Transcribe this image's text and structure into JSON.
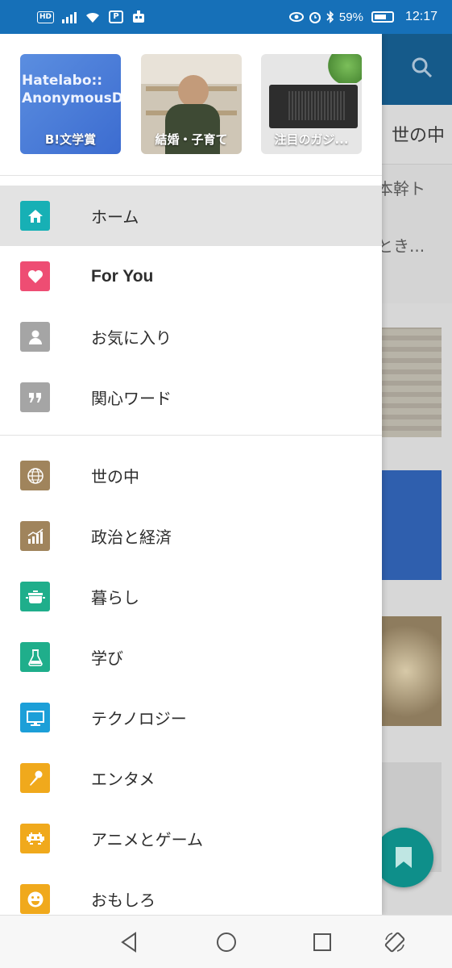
{
  "status_bar": {
    "badge": "HD",
    "battery": "59%",
    "time": "12:17",
    "color": "#1670b8"
  },
  "background_app": {
    "tab": "世の中",
    "article_line1": "本幹ト",
    "article_line2": "とき..."
  },
  "featured": [
    {
      "label": "B!文学賞",
      "overlay": "Hatelabo::\nAnonymousDiary"
    },
    {
      "label": "結婚・子育て"
    },
    {
      "label": "注目のガジ..."
    }
  ],
  "menu_primary": [
    {
      "label": "ホーム",
      "icon": "home-icon",
      "color": "#17b0b5",
      "selected": true
    },
    {
      "label": "For You",
      "icon": "heart-icon",
      "color": "#ee4d73",
      "selected": false
    },
    {
      "label": "お気に入り",
      "icon": "person-icon",
      "color": "#a5a5a5",
      "selected": false
    },
    {
      "label": "関心ワード",
      "icon": "quote-icon",
      "color": "#a5a5a5",
      "selected": false
    }
  ],
  "menu_categories": [
    {
      "label": "世の中",
      "icon": "globe-icon",
      "color": "#a0845c"
    },
    {
      "label": "政治と経済",
      "icon": "bar-chart-icon",
      "color": "#a0845c"
    },
    {
      "label": "暮らし",
      "icon": "pot-icon",
      "color": "#1fae8b"
    },
    {
      "label": "学び",
      "icon": "flask-icon",
      "color": "#1fae8b"
    },
    {
      "label": "テクノロジー",
      "icon": "monitor-icon",
      "color": "#1c9fd8"
    },
    {
      "label": "エンタメ",
      "icon": "microphone-icon",
      "color": "#f0a91c"
    },
    {
      "label": "アニメとゲーム",
      "icon": "invader-icon",
      "color": "#f0a91c"
    },
    {
      "label": "おもしろ",
      "icon": "smiley-icon",
      "color": "#f0a91c"
    }
  ]
}
